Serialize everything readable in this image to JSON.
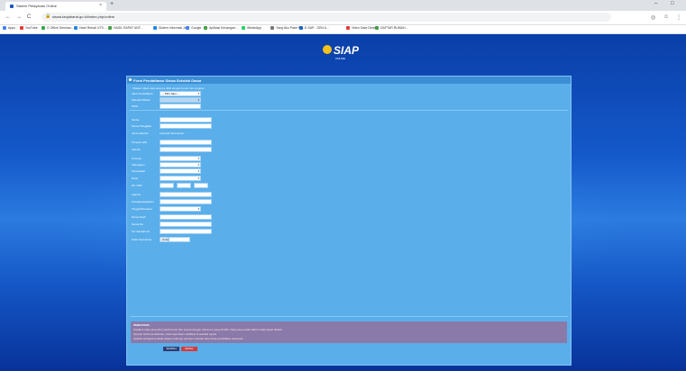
{
  "browser": {
    "tab_title": "Sistem Pelayanan Online",
    "tab_close": "×",
    "new_tab": "+",
    "win_min": "–",
    "win_max": "□",
    "url": "siswa.tanjabarat.go.id/index.php/online",
    "back": "←",
    "forward": "→",
    "reload": "C",
    "lock": "🔒",
    "bookmarks": [
      {
        "label": "Apps",
        "color": "#4285f4"
      },
      {
        "label": "YouTube",
        "color": "#e53935"
      },
      {
        "label": "G Office Seminar...",
        "color": "#34a853"
      },
      {
        "label": "Hasil Rekab UTS...",
        "color": "#1e88e5"
      },
      {
        "label": "HASIL RAPAT ANT...",
        "color": "#43a047"
      },
      {
        "label": "Sistem Informasi Ja...",
        "color": "#1e88e5"
      },
      {
        "label": "Google",
        "color": "#4285f4"
      },
      {
        "label": "Aplikasi Keuangan...",
        "color": "#43a047"
      },
      {
        "label": "WhatsApp",
        "color": "#25d366"
      },
      {
        "label": "Yang Aku Pake Pe...",
        "color": "#777777"
      },
      {
        "label": "E-SAP - SDN 6...",
        "color": "#1565c0"
      },
      {
        "label": "Video Data Dinas...",
        "color": "#e53935"
      },
      {
        "label": "DAFTAR RUMAH...",
        "color": "#43a047"
      }
    ]
  },
  "logo": {
    "text": "SIAP",
    "sub": "ONLINE"
  },
  "panel": {
    "title": "Form Pendaftaran Siswa Sekolah Dasar",
    "note": "Silakan isikan data peserta didik dengan benar dan lengkap",
    "fields": [
      {
        "label": "Jalur Pendaftaran",
        "type": "select",
        "value": "-- Pilih Jalur --"
      },
      {
        "label": "Sekolah Pilihan",
        "type": "select-dark",
        "value": ""
      },
      {
        "label": "NISN",
        "type": "input",
        "value": ""
      },
      {
        "label": "Nama",
        "type": "input",
        "value": ""
      },
      {
        "label": "Nama Panggilan",
        "type": "input",
        "value": ""
      },
      {
        "label": "Jenis Kelamin",
        "type": "radio",
        "value": "Laki-laki  Perempuan"
      },
      {
        "label": "Tempat Lahir",
        "type": "input",
        "value": ""
      },
      {
        "label": "Alamat",
        "type": "input",
        "value": ""
      },
      {
        "label": "Provinsi",
        "type": "select",
        "value": ""
      },
      {
        "label": "Kabupaten",
        "type": "select",
        "value": ""
      },
      {
        "label": "Kecamatan",
        "type": "select",
        "value": ""
      },
      {
        "label": "Desa",
        "type": "select",
        "value": ""
      },
      {
        "label": "RT / RW",
        "type": "triple",
        "value": ""
      },
      {
        "label": "Agama",
        "type": "input",
        "value": ""
      },
      {
        "label": "Kewarganegaraan",
        "type": "input",
        "value": ""
      },
      {
        "label": "Tinggal Bersama",
        "type": "select",
        "value": ""
      },
      {
        "label": "Nama Ayah",
        "type": "input",
        "value": ""
      },
      {
        "label": "Nama Ibu",
        "type": "input",
        "value": ""
      },
      {
        "label": "No Handphone",
        "type": "input",
        "value": ""
      },
      {
        "label": "Kode Keamanan",
        "type": "captcha",
        "value": "kode"
      }
    ],
    "notice_title": "PERHATIAN :",
    "notice_lines": [
      "Pastikan data yang diisi sudah benar dan sesuai dengan dokumen yang dimiliki. Data yang sudah dikirim tidak dapat diubah.",
      "Simpan bukti pendaftaran untuk keperluan verifikasi di sekolah tujuan.",
      "Apabila terdapat kendala silakan hubungi operator sekolah atau dinas pendidikan setempat."
    ],
    "save_label": "SIMPAN",
    "cancel_label": "BATAL"
  }
}
